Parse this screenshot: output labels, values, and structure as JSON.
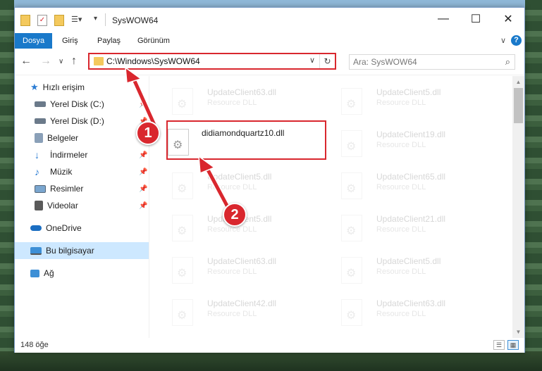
{
  "window": {
    "title": "SysWOW64",
    "controls": {
      "minimize": "—",
      "maximize": "☐",
      "close": "✕"
    }
  },
  "ribbon": {
    "tabs": [
      "Dosya",
      "Giriş",
      "Paylaş",
      "Görünüm"
    ],
    "expand_glyph": "∨",
    "help_glyph": "?"
  },
  "navigation": {
    "back": "←",
    "forward": "→",
    "recent": "∨",
    "up": "↑",
    "address": "C:\\Windows\\SysWOW64",
    "address_chevron": "∨",
    "refresh": "↻",
    "search_placeholder": "Ara: SysWOW64",
    "search_glyph": "⌕"
  },
  "sidebar": {
    "items": [
      {
        "label": "Hızlı erişim",
        "icon": "star-icon",
        "color": "#2b7cd3"
      },
      {
        "label": "Yerel Disk (C:)",
        "icon": "drive-icon",
        "color": "#6b7a8a",
        "pinned": true
      },
      {
        "label": "Yerel Disk (D:)",
        "icon": "drive-icon",
        "color": "#6b7a8a",
        "pinned": true
      },
      {
        "label": "Belgeler",
        "icon": "documents-icon",
        "color": "#8aa0b8",
        "pinned": true
      },
      {
        "label": "İndirmeler",
        "icon": "download-icon",
        "color": "#2b7cd3",
        "pinned": true
      },
      {
        "label": "Müzik",
        "icon": "music-icon",
        "color": "#2b7cd3",
        "pinned": true
      },
      {
        "label": "Resimler",
        "icon": "pictures-icon",
        "color": "#7aa6cf",
        "pinned": true
      },
      {
        "label": "Videolar",
        "icon": "video-icon",
        "color": "#5a5a5a",
        "pinned": true
      },
      {
        "label": "OneDrive",
        "icon": "cloud-icon",
        "color": "#1b6ec2"
      },
      {
        "label": "Bu bilgisayar",
        "icon": "computer-icon",
        "color": "#3d8fd6",
        "selected": true
      },
      {
        "label": "Ağ",
        "icon": "network-icon",
        "color": "#3d8fd6"
      }
    ],
    "pin_glyph": "📌"
  },
  "files": {
    "left": [
      {
        "name": "UpdateClient63.dll",
        "type": "Resource DLL",
        "faded": true
      },
      {
        "name": "didiamondquartz10.dll",
        "type": "",
        "faded": false,
        "highlighted": true
      },
      {
        "name": "UpdateClient5.dll",
        "type": "Resource DLL",
        "faded": true
      },
      {
        "name": "UpdateClient5.dll",
        "type": "Resource DLL",
        "faded": true
      },
      {
        "name": "UpdateClient63.dll",
        "type": "Resource DLL",
        "faded": true
      },
      {
        "name": "UpdateClient42.dll",
        "type": "Resource DLL",
        "faded": true
      }
    ],
    "right": [
      {
        "name": "UpdateClient5.dll",
        "type": "Resource DLL"
      },
      {
        "name": "UpdateClient19.dll",
        "type": "Resource DLL"
      },
      {
        "name": "UpdateClient65.dll",
        "type": "Resource DLL"
      },
      {
        "name": "UpdateClient21.dll",
        "type": "Resource DLL"
      },
      {
        "name": "UpdateClient5.dll",
        "type": "Resource DLL"
      },
      {
        "name": "UpdateClient63.dll",
        "type": "Resource DLL"
      }
    ]
  },
  "status": {
    "count": "148 öğe"
  },
  "callouts": [
    "1",
    "2"
  ],
  "colors": {
    "accent": "#1979ca",
    "highlight": "#d9272e",
    "selection": "#cde8ff"
  }
}
